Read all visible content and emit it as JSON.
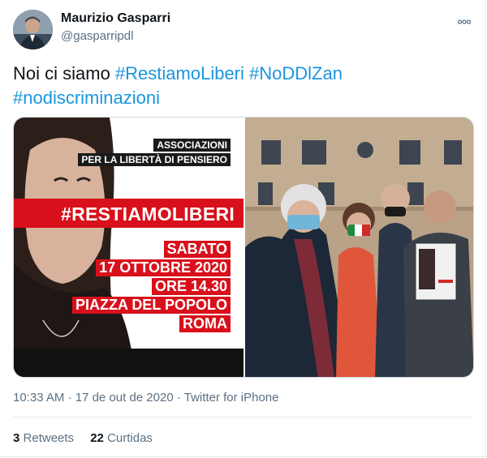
{
  "author": {
    "name": "Maurizio Gasparri",
    "handle": "@gasparripdl"
  },
  "tweet": {
    "text_plain": "Noi ci siamo",
    "hashtags": [
      "#RestiamoLiberi",
      "#NoDDlZan",
      "#nodiscriminazioni"
    ]
  },
  "media": {
    "poster": {
      "line1": "ASSOCIAZIONI",
      "line2": "PER LA LIBERTÀ DI PENSIERO",
      "hashtag": "#RESTIAMOLIBERI",
      "day": "SABATO",
      "date": "17 OTTOBRE 2020",
      "time": "ORE 14.30",
      "place": "PIAZZA DEL POPOLO",
      "city": "ROMA"
    }
  },
  "meta": {
    "time": "10:33 AM",
    "sep1": "·",
    "date": "17 de out de 2020",
    "sep2": "·",
    "source": "Twitter for iPhone"
  },
  "stats": {
    "retweets_count": "3",
    "retweets_label": "Retweets",
    "likes_count": "22",
    "likes_label": "Curtidas"
  },
  "colors": {
    "hashtag": "#1b95e0",
    "poster_red": "#d8101b",
    "secondary_text": "#5b7083"
  }
}
